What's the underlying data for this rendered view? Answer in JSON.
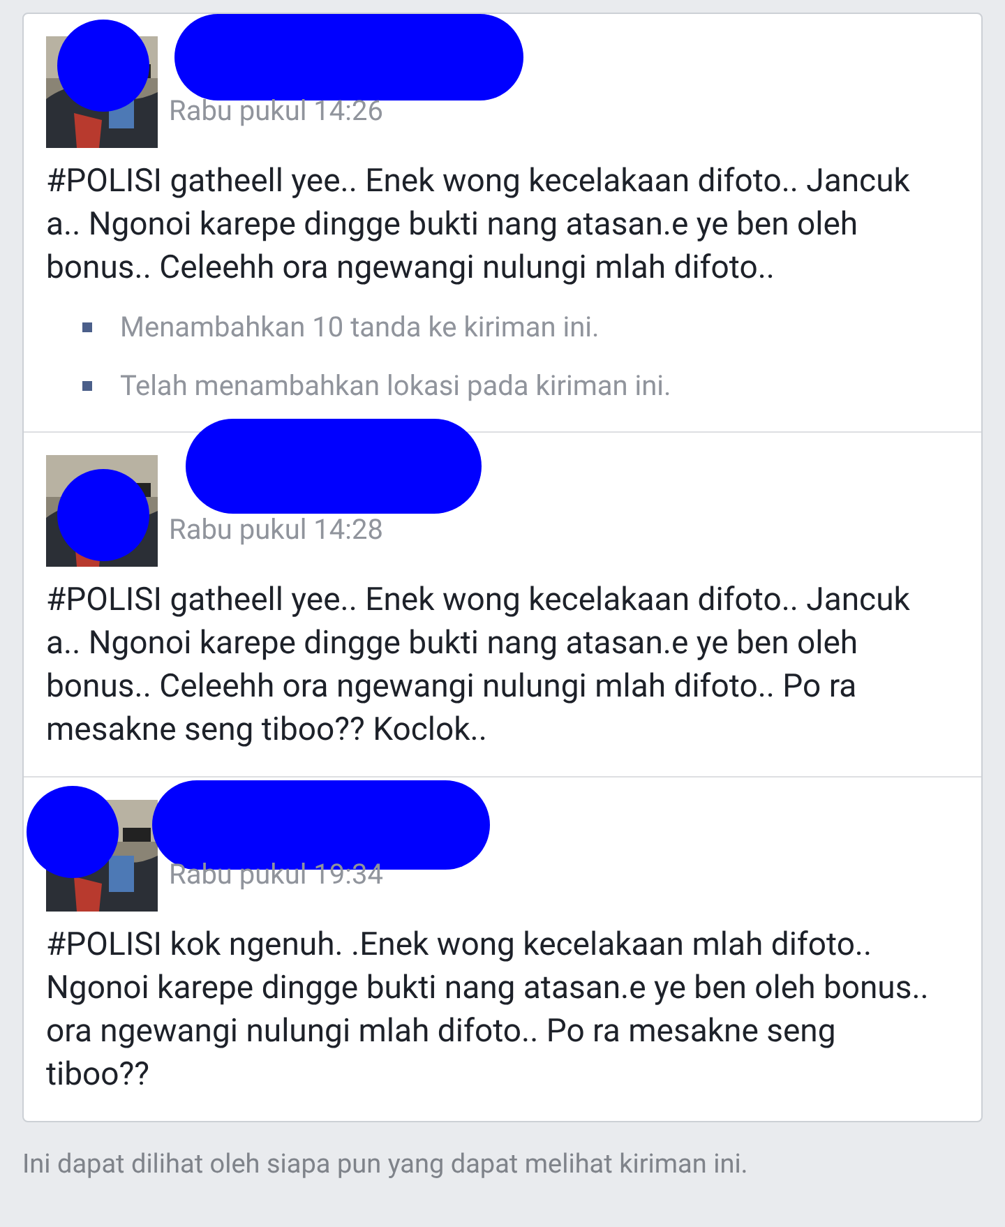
{
  "edits": [
    {
      "time": "Rabu pukul 14:26",
      "text": "#POLISI gatheell yee.. Enek wong kecelakaan difoto.. Jancuk a.. Ngonoi karepe dingge bukti nang atasan.e ye ben oleh bonus.. Celeehh ora ngewangi nulungi mlah difoto..",
      "notes": [
        "Menambahkan 10 tanda ke kiriman ini.",
        "Telah menambahkan lokasi pada kiriman ini."
      ]
    },
    {
      "time": "Rabu pukul 14:28",
      "text": "#POLISI gatheell yee.. Enek wong kecelakaan difoto.. Jancuk a.. Ngonoi karepe dingge bukti nang atasan.e ye ben oleh bonus.. Celeehh ora ngewangi nulungi mlah difoto.. Po ra mesakne seng tiboo?? Koclok.."
    },
    {
      "time": "Rabu pukul 19:34",
      "text": "#POLISI kok ngenuh. .Enek wong kecelakaan mlah difoto.. Ngonoi karepe dingge bukti nang atasan.e ye ben oleh bonus.. ora ngewangi nulungi mlah difoto.. Po ra mesakne seng tiboo??"
    }
  ],
  "footer": "Ini dapat dilihat oleh siapa pun yang dapat melihat kiriman ini."
}
